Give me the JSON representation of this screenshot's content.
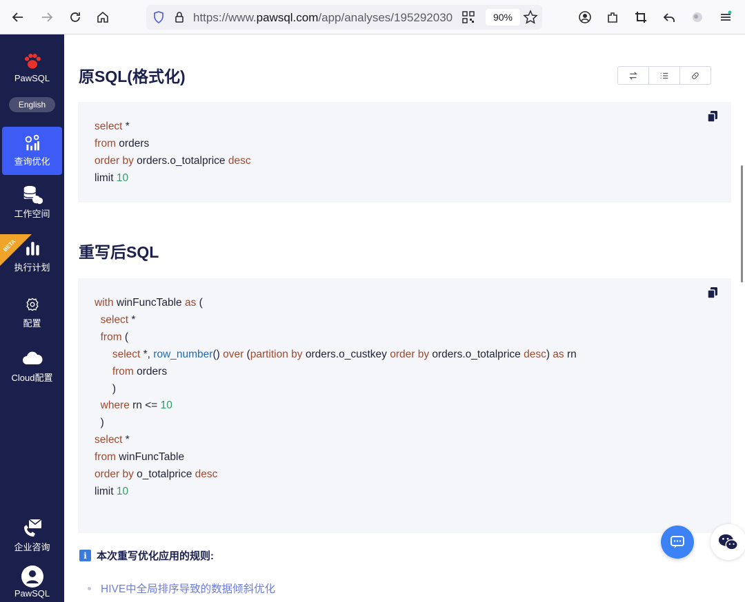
{
  "browser": {
    "url_prefix": "https://www.",
    "url_domain": "pawsql.com",
    "url_path": "/app/analyses/195292030",
    "zoom": "90%"
  },
  "sidebar": {
    "brand": "PawSQL",
    "language": "English",
    "items": [
      {
        "label": "查询优化",
        "icon": "query-optimize-icon",
        "active": true
      },
      {
        "label": "工作空间",
        "icon": "workspace-icon"
      },
      {
        "label": "执行计划",
        "icon": "execution-plan-icon",
        "badge": "BETA"
      },
      {
        "label": "配置",
        "icon": "settings-icon"
      },
      {
        "label": "Cloud配置",
        "icon": "cloud-icon"
      }
    ],
    "bottom": [
      {
        "label": "企业咨询",
        "icon": "consult-icon"
      },
      {
        "label": "PawSQL",
        "icon": "user-avatar-icon"
      }
    ]
  },
  "main": {
    "original_title": "原SQL(格式化)",
    "rewritten_title": "重写后SQL",
    "rules_title": "本次重写优化应用的规则:",
    "rules": [
      "HIVE中全局排序导致的数据倾斜优化"
    ]
  },
  "colors": {
    "sidebar_bg": "#1b1f4b",
    "active_item": "#3d5cf5",
    "keyword": "#a0492d",
    "number": "#2e9c6a",
    "function": "#1f6bb5",
    "rule_link": "#6c7ce0"
  }
}
